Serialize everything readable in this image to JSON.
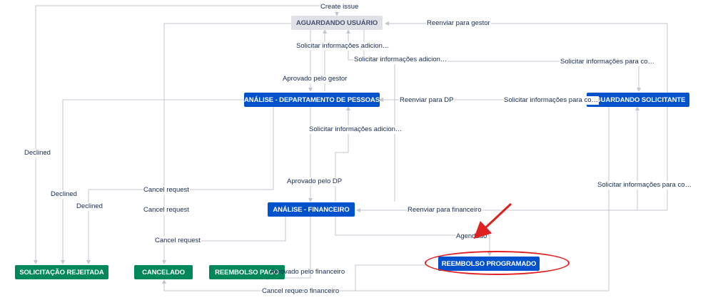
{
  "nodes": {
    "aguardando_usuario": "AGUARDANDO USUÁRIO",
    "analise_dp": "ANÁLISE - DEPARTAMENTO DE PESSOAS",
    "aguardando_solicitante": "AGUARDANDO SOLICITANTE",
    "analise_financeiro": "ANÁLISE - FINANCEIRO",
    "solicitacao_rejeitada": "SOLICITAÇÃO REJEITADA",
    "cancelado": "CANCELADO",
    "reembolso_pago": "REEMBOLSO PAGO",
    "reembolso_programado": "REEMBOLSO PROGRAMADO"
  },
  "edge_labels": {
    "create_issue": "Create issue",
    "reenviar_gestor": "Reenviar para gestor",
    "solicitar_info_1": "Solicitar informações adicion…",
    "solicitar_info_2": "Solicitar informações adicion…",
    "solicitar_info_co_1": "Solicitar informações para co…",
    "aprovado_gestor": "Aprovado pelo gestor",
    "reenviar_dp": "Reenviar para DP",
    "solicitar_info_co_2": "Solicitar informações para co…",
    "solicitar_info_3": "Solicitar informações adicion…",
    "declined_1": "Declined",
    "declined_2": "Declined",
    "declined_3": "Declined",
    "aprovado_dp": "Aprovado pelo DP",
    "solicitar_info_co_3": "Solicitar informações para co…",
    "cancel_request_1": "Cancel request",
    "cancel_request_2": "Cancel request",
    "reenviar_financeiro": "Reenviar para financeiro",
    "cancel_request_3": "Cancel request",
    "agendado": "Agendado",
    "aprovado_financeiro": "Aprovado pelo financeiro",
    "cancel_request_4": "Cancel request",
    "financeiro_partial": "o financeiro"
  },
  "colors": {
    "status_todo": "#dfe1e6",
    "status_in_progress": "#0052cc",
    "status_done": "#00875a",
    "highlight": "#e02020",
    "edge": "#c1c7d0"
  }
}
